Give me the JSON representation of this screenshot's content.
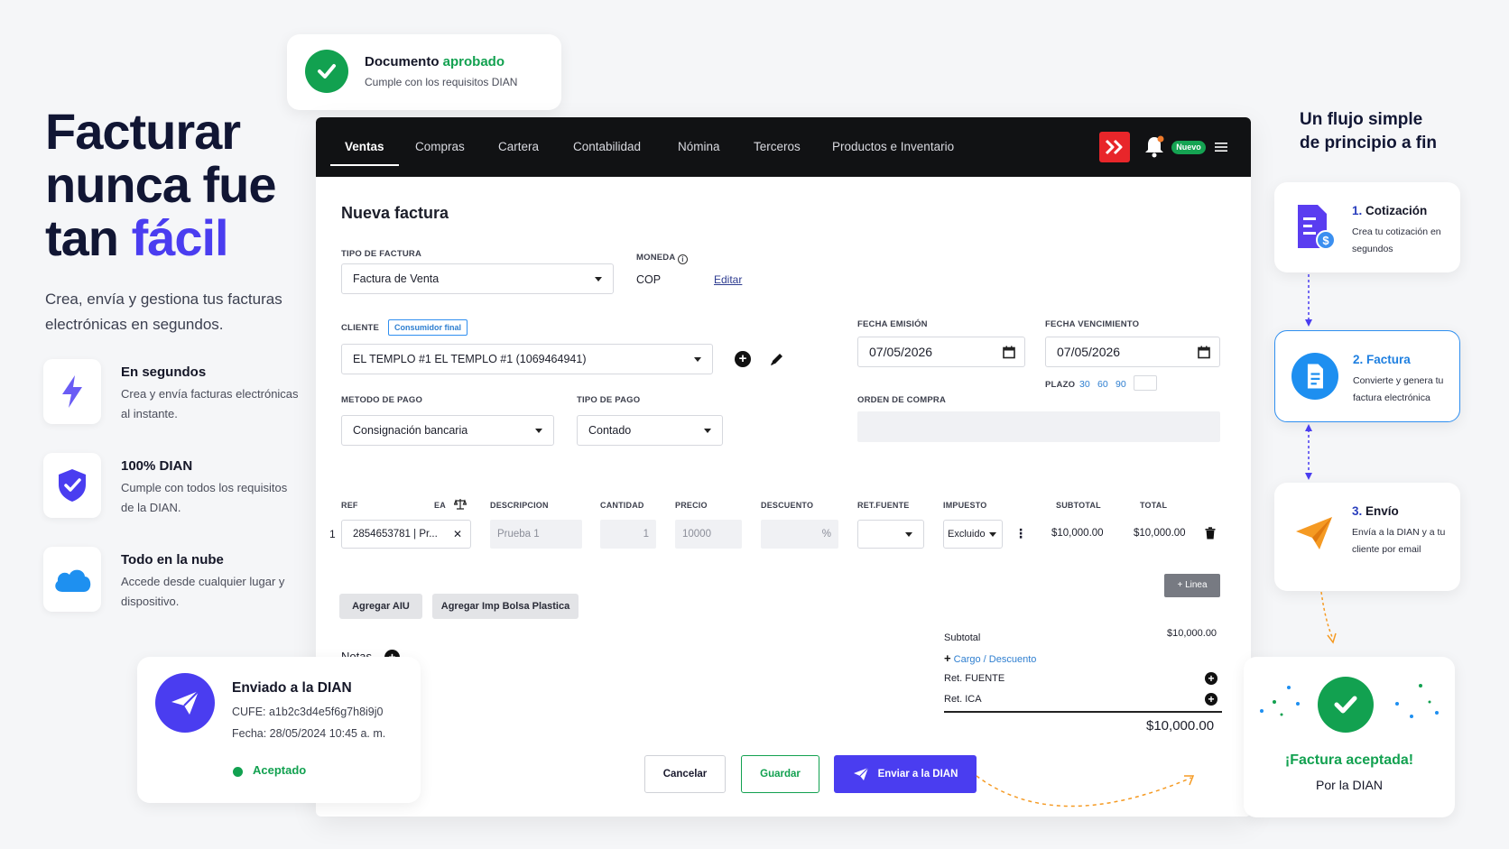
{
  "hero": {
    "title_line1": "Facturar",
    "title_line2": "nunca fue",
    "title_line3_plain": "tan ",
    "title_line3_accent": "fácil",
    "subtitle": "Crea, envía y gestiona tus facturas electrónicas en segundos.",
    "features": [
      {
        "icon": "lightning-icon",
        "title": "En segundos",
        "desc": "Crea y envía facturas electrónicas al instante."
      },
      {
        "icon": "shield-check-icon",
        "title": "100% DIAN",
        "desc": "Cumple con todos los requisitos de la DIAN."
      },
      {
        "icon": "cloud-icon",
        "title": "Todo en la nube",
        "desc": "Accede desde cualquier lugar y dispositivo."
      }
    ]
  },
  "approved_badge": {
    "title_plain": "Documento ",
    "title_accent": "aprobado",
    "subtitle": "Cumple con los requisitos DIAN"
  },
  "nav": {
    "tabs": [
      "Ventas",
      "Compras",
      "Cartera",
      "Contabilidad",
      "Nómina",
      "Terceros",
      "Productos e Inventario"
    ],
    "active_tab": "Ventas",
    "new_badge": "Nuevo"
  },
  "invoice": {
    "title": "Nueva factura",
    "tipo_factura_label": "TIPO DE FACTURA",
    "tipo_factura_value": "Factura de Venta",
    "moneda_label": "MONEDA",
    "moneda_value": "COP",
    "edit_link": "Editar",
    "cliente_label": "CLIENTE",
    "cliente_tag": "Consumidor final",
    "cliente_value": "EL TEMPLO #1 EL TEMPLO #1 (1069464941)",
    "fecha_emision_label": "FECHA EMISIÓN",
    "fecha_emision_value": "07/05/2026",
    "fecha_venc_label": "FECHA VENCIMIENTO",
    "fecha_venc_value": "07/05/2026",
    "plazo_label": "PLAZO",
    "plazo_options": [
      "30",
      "60",
      "90"
    ],
    "metodo_pago_label": "METODO DE PAGO",
    "metodo_pago_value": "Consignación bancaria",
    "tipo_pago_label": "TIPO DE PAGO",
    "tipo_pago_value": "Contado",
    "orden_compra_label": "ORDEN DE COMPRA",
    "columns": [
      "REF",
      "EA",
      "DESCRIPCION",
      "CANTIDAD",
      "PRECIO",
      "DESCUENTO",
      "RET.FUENTE",
      "IMPUESTO",
      "SUBTOTAL",
      "TOTAL"
    ],
    "row": {
      "num": "1",
      "ref": "2854653781 | Pr...",
      "descripcion": "Prueba 1",
      "cantidad": "1",
      "precio": "10000",
      "descuento_unit": "%",
      "impuesto": "Excluido",
      "subtotal": "$10,000.00",
      "total": "$10,000.00"
    },
    "add_line": "+ Linea",
    "btn_aiu": "Agregar AIU",
    "btn_bolsa": "Agregar Imp Bolsa Plastica",
    "notas_label": "Notas",
    "summary": {
      "subtotal_label": "Subtotal",
      "subtotal_value": "$10,000.00",
      "cargo_link": "Cargo / Descuento",
      "ret_fuente_label": "Ret. FUENTE",
      "ret_ica_label": "Ret. ICA",
      "grand_total": "$10,000.00"
    },
    "btn_cancel": "Cancelar",
    "btn_save": "Guardar",
    "btn_send": "Enviar a la DIAN"
  },
  "flow": {
    "title_line1": "Un flujo simple",
    "title_line2": "de principio a fin",
    "steps": [
      {
        "num": "1.",
        "title": " Cotización",
        "desc": "Crea tu cotización en segundos"
      },
      {
        "num": "2.",
        "title": " Factura",
        "desc": "Convierte y genera tu factura electrónica"
      },
      {
        "num": "3.",
        "title": " Envío",
        "desc": "Envía a la DIAN y a tu cliente por email"
      }
    ],
    "accepted_title": "¡Factura aceptada!",
    "accepted_sub": "Por la DIAN"
  },
  "sent_card": {
    "title": "Enviado a la DIAN",
    "cufe": "CUFE: a1b2c3d4e5f6g7h8i9j0",
    "fecha": "Fecha: 28/05/2024 10:45 a. m.",
    "status": "Aceptado"
  },
  "colors": {
    "brand": "#4a3df0",
    "success": "#12a150",
    "nav_bg": "#111214",
    "logo_red": "#e8262a",
    "flow_blue": "#2f8ff0"
  }
}
